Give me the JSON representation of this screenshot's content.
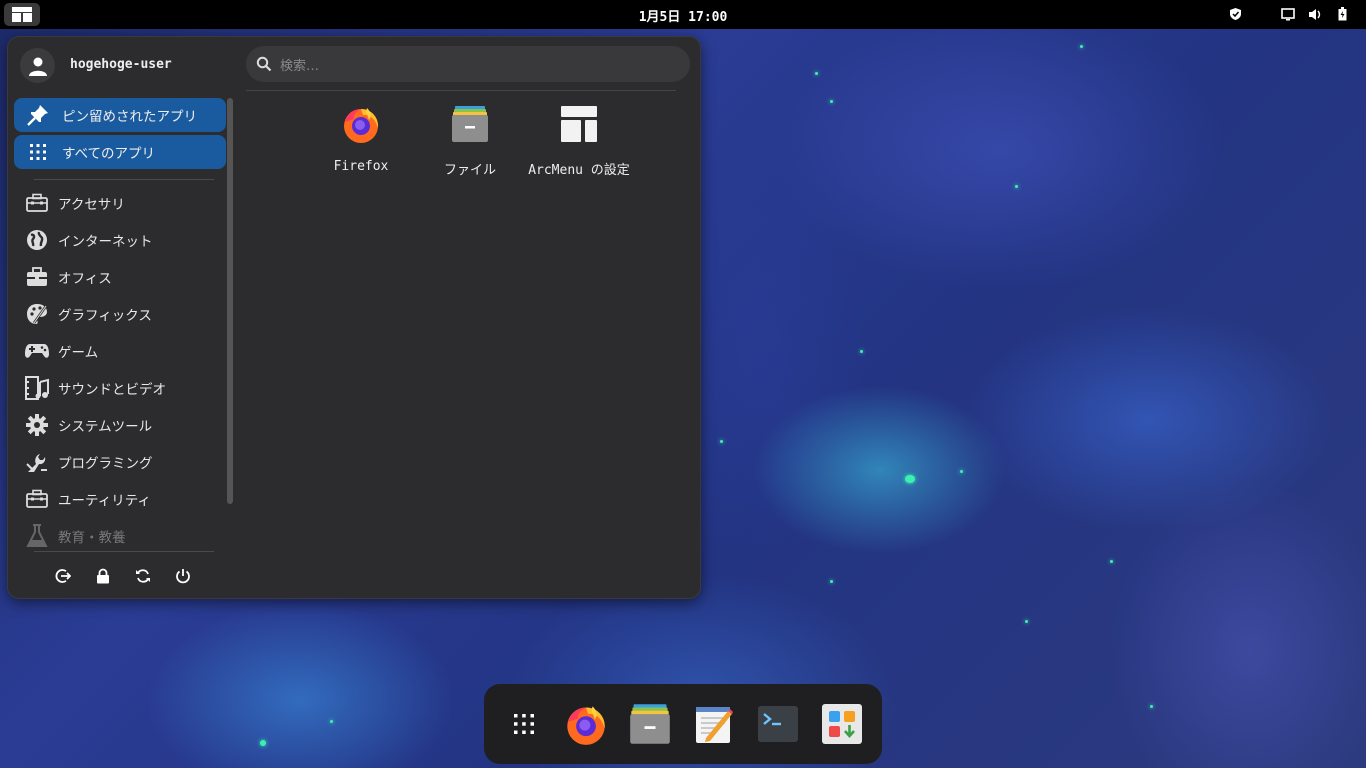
{
  "topbar": {
    "clock": "1月5日 17:00",
    "tray_icons": [
      "shield-icon",
      "display-icon",
      "volume-icon",
      "battery-icon"
    ]
  },
  "menu": {
    "user": {
      "name": "hogehoge-user"
    },
    "search": {
      "placeholder": "検索…"
    },
    "nav": [
      {
        "label": "ピン留めされたアプリ",
        "icon": "pin-icon",
        "active": true
      },
      {
        "label": "すべてのアプリ",
        "icon": "grid-icon",
        "active": true
      }
    ],
    "categories": [
      {
        "label": "アクセサリ",
        "icon": "toolbox-icon"
      },
      {
        "label": "インターネット",
        "icon": "globe-icon"
      },
      {
        "label": "オフィス",
        "icon": "briefcase-icon"
      },
      {
        "label": "グラフィックス",
        "icon": "palette-icon"
      },
      {
        "label": "ゲーム",
        "icon": "gamepad-icon"
      },
      {
        "label": "サウンドとビデオ",
        "icon": "film-music-icon"
      },
      {
        "label": "システムツール",
        "icon": "gear-icon"
      },
      {
        "label": "プログラミング",
        "icon": "wrench-icon"
      },
      {
        "label": "ユーティリティ",
        "icon": "toolbox-icon"
      },
      {
        "label": "教育・教養",
        "icon": "flask-icon"
      }
    ],
    "pinned_apps": [
      {
        "label": "Firefox",
        "icon": "firefox-icon"
      },
      {
        "label": "ファイル",
        "icon": "files-icon"
      },
      {
        "label": "ArcMenu の設定",
        "icon": "arcmenu-settings-icon"
      }
    ],
    "actions": [
      "logout-icon",
      "lock-icon",
      "restart-icon",
      "power-icon"
    ]
  },
  "dock": {
    "items": [
      "app-grid-icon",
      "firefox-icon",
      "files-icon",
      "text-editor-icon",
      "terminal-icon",
      "software-icon"
    ]
  }
}
